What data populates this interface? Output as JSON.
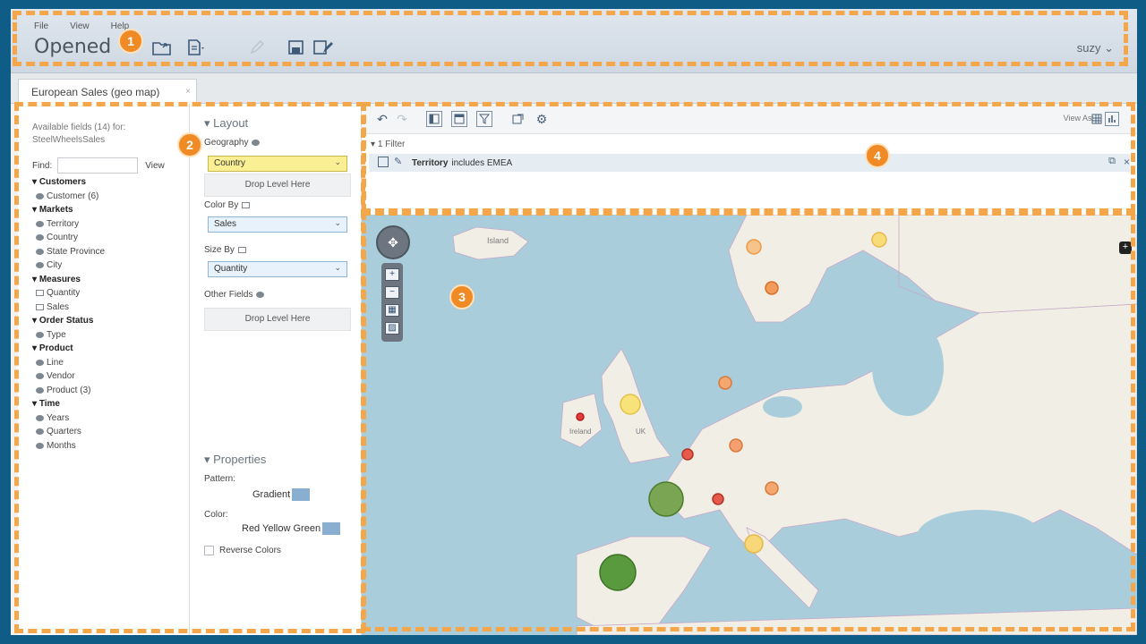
{
  "menu": [
    "File",
    "View",
    "Help"
  ],
  "app_title": "Opened",
  "user": "suzy ⌄",
  "tab": {
    "label": "European Sales (geo map)",
    "close": "×"
  },
  "fields": {
    "available": "Available fields (14) for:",
    "model": "SteelWheelsSales",
    "find_label": "Find:",
    "view_label": "View",
    "groups": [
      {
        "name": "Customers",
        "items": [
          "Customer (6)"
        ]
      },
      {
        "name": "Markets",
        "items": [
          "Territory",
          "Country",
          "State Province",
          "City"
        ]
      },
      {
        "name": "Measures",
        "items": [
          "Quantity",
          "Sales"
        ]
      },
      {
        "name": "Order Status",
        "items": [
          "Type"
        ]
      },
      {
        "name": "Product",
        "items": [
          "Line",
          "Vendor",
          "Product (3)"
        ]
      },
      {
        "name": "Time",
        "items": [
          "Years",
          "Quarters",
          "Months"
        ]
      }
    ]
  },
  "layout": {
    "title": "Layout",
    "geography_label": "Geography",
    "geography_value": "Country",
    "drop_level": "Drop Level Here",
    "color_by_label": "Color By",
    "color_by_value": "Sales",
    "size_by_label": "Size By",
    "size_by_value": "Quantity",
    "other_fields_label": "Other Fields",
    "properties_title": "Properties",
    "pattern_label": "Pattern:",
    "pattern_value": "Gradient",
    "color_label": "Color:",
    "color_value": "Red Yellow Green",
    "reverse_label": "Reverse Colors"
  },
  "toolbar": {
    "view_as": "View As:"
  },
  "filters": {
    "header": "1 Filter",
    "field": "Territory",
    "condition": "includes EMEA"
  },
  "map_labels": {
    "iceland": "Island",
    "ireland": "Ireland",
    "uk": "UK"
  },
  "badges": [
    "1",
    "2",
    "3",
    "4"
  ],
  "colors": {
    "accent": "#f08a24",
    "dash": "#f4a64b",
    "frame": "#0f5d86"
  }
}
